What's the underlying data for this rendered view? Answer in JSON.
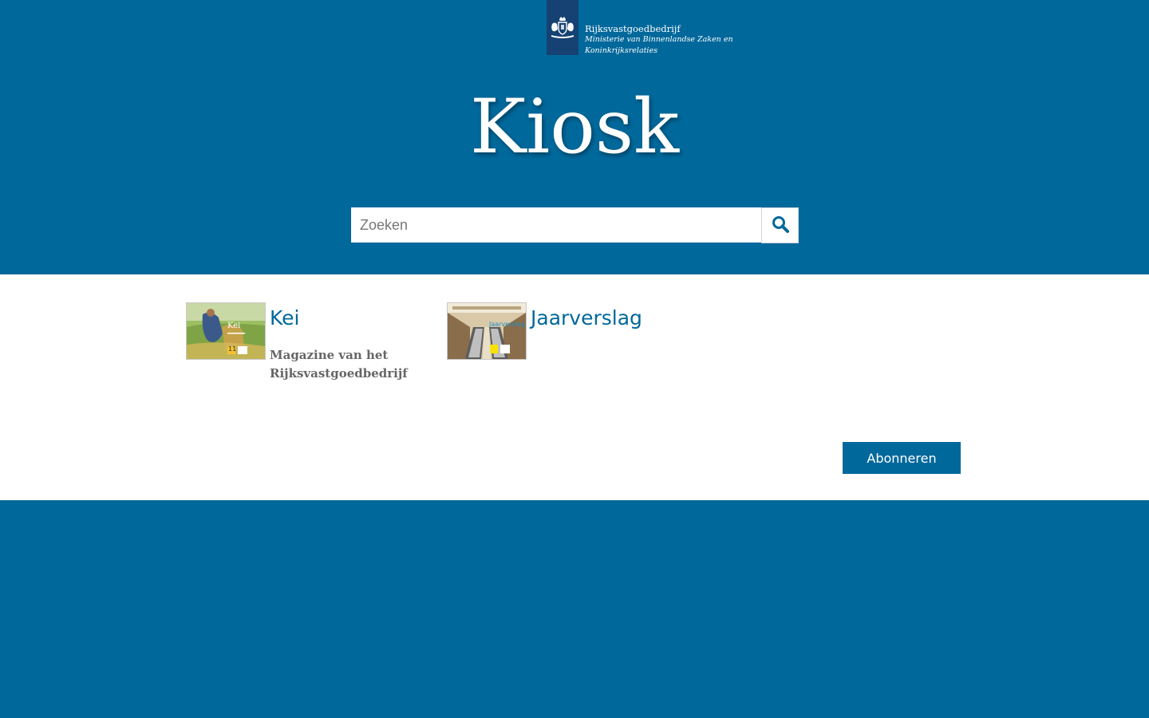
{
  "header": {
    "logo": {
      "icon": "crest-icon",
      "organization": "Rijksvastgoedbedrijf",
      "ministry_line1": "Ministerie van Binnenlandse Zaken en",
      "ministry_line2": "Koninkrijksrelaties"
    },
    "title": "Kiosk",
    "search": {
      "placeholder": "Zoeken",
      "value": "",
      "button_icon": "search-icon"
    }
  },
  "publications": [
    {
      "title": "Kei",
      "description": "Magazine van het Rijksvastgoedbedrijf",
      "thumbnail_icon": "kei-cover-thumbnail",
      "cover_title": "Kei",
      "cover_number": "11"
    },
    {
      "title": "Jaarverslag",
      "description": "",
      "thumbnail_icon": "jaarverslag-cover-thumbnail",
      "cover_title": "Jaarverslag"
    }
  ],
  "actions": {
    "subscribe_label": "Abonneren"
  },
  "colors": {
    "brand_blue": "#01689b",
    "logo_dark_blue": "#154273",
    "text_gray": "#666666",
    "background": "#ffffff"
  }
}
